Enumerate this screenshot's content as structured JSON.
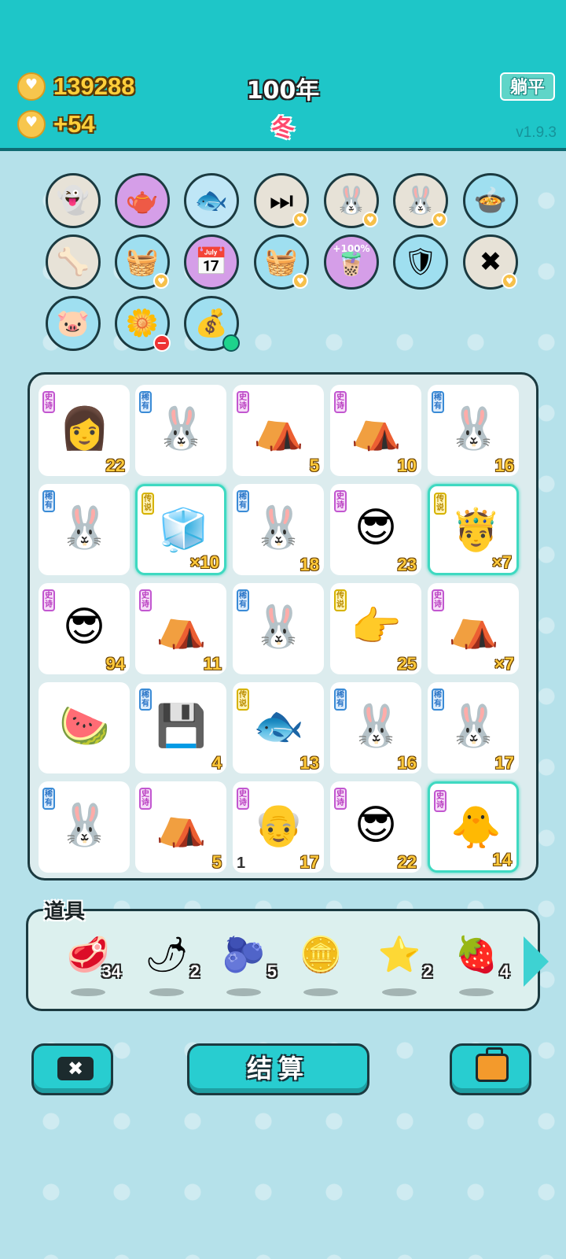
{
  "header": {
    "coins": "139288",
    "income": "+54",
    "year": "100年",
    "season": "冬",
    "flat_button": "躺平",
    "version": "v1.9.3"
  },
  "buffs": [
    {
      "icon": "ghost-icon",
      "glyph": "👻",
      "bg": "beige"
    },
    {
      "icon": "gravy-boat-icon",
      "glyph": "🫖",
      "bg": "purple"
    },
    {
      "icon": "fishbowl-icon",
      "glyph": "🐟",
      "bg": "blue"
    },
    {
      "icon": "skip-icon",
      "glyph": "⏭",
      "bg": "beige"
    },
    {
      "icon": "bunny-icon",
      "glyph": "🐰",
      "bg": "beige"
    },
    {
      "icon": "bunny-icon",
      "glyph": "🐰",
      "bg": "beige"
    },
    {
      "icon": "duck-pot-icon",
      "glyph": "🍲",
      "bg": "cyan"
    },
    {
      "icon": "dog-bowl-icon",
      "glyph": "🦴",
      "bg": "beige"
    },
    {
      "icon": "fruit-basket-icon",
      "glyph": "🧺",
      "bg": "cyan"
    },
    {
      "icon": "calendar-icon",
      "glyph": "📅",
      "bg": "purple"
    },
    {
      "icon": "fruit-basket-icon",
      "glyph": "🧺",
      "bg": "cyan"
    },
    {
      "icon": "milk-tea-icon",
      "glyph": "🧋",
      "bg": "purple",
      "label": "+100%"
    },
    {
      "icon": "shield-wrench-icon",
      "glyph": "🛡",
      "bg": "cyan"
    },
    {
      "icon": "delete-tag-icon",
      "glyph": "✖",
      "bg": "beige"
    },
    {
      "icon": "piggy-bank-icon",
      "glyph": "🐷",
      "bg": "cyan"
    },
    {
      "icon": "flower-pot-icon",
      "glyph": "🌼",
      "bg": "cyan"
    },
    {
      "icon": "sack-icon",
      "glyph": "💰",
      "bg": "cyan"
    }
  ],
  "rarity_labels": {
    "epic": "史诗",
    "rare": "稀有",
    "legendary": "传说"
  },
  "board": [
    {
      "name": "girl-portrait",
      "glyph": "👩",
      "rarity": "epic",
      "count": "22"
    },
    {
      "name": "bunny",
      "glyph": "🐰",
      "rarity": "rare",
      "count": ""
    },
    {
      "name": "bunny-tent",
      "glyph": "⛺",
      "rarity": "epic",
      "count": "5"
    },
    {
      "name": "bunny-tent",
      "glyph": "⛺",
      "rarity": "epic",
      "count": "10"
    },
    {
      "name": "bunny",
      "glyph": "🐰",
      "rarity": "rare",
      "count": "16"
    },
    {
      "name": "bunny",
      "glyph": "🐰",
      "rarity": "rare",
      "count": ""
    },
    {
      "name": "fridge",
      "glyph": "🧊",
      "rarity": "legendary",
      "count": "×10",
      "highlight": true
    },
    {
      "name": "bunny",
      "glyph": "🐰",
      "rarity": "rare",
      "count": "18"
    },
    {
      "name": "green-hat-man",
      "glyph": "😎",
      "rarity": "epic",
      "count": "23"
    },
    {
      "name": "king-egg",
      "glyph": "🤴",
      "rarity": "legendary",
      "count": "×7",
      "highlight": true
    },
    {
      "name": "green-hat-man",
      "glyph": "😎",
      "rarity": "epic",
      "count": "94"
    },
    {
      "name": "bunny-tent",
      "glyph": "⛺",
      "rarity": "epic",
      "count": "11"
    },
    {
      "name": "bunny",
      "glyph": "🐰",
      "rarity": "rare",
      "count": ""
    },
    {
      "name": "pointing-hand",
      "glyph": "👉",
      "rarity": "legendary",
      "count": "25"
    },
    {
      "name": "bunny-tent",
      "glyph": "⛺",
      "rarity": "epic",
      "count": "×7"
    },
    {
      "name": "watermelon",
      "glyph": "🍉",
      "rarity": "",
      "count": ""
    },
    {
      "name": "cpu-chip",
      "glyph": "💾",
      "rarity": "rare",
      "count": "4"
    },
    {
      "name": "koi-fish",
      "glyph": "🐟",
      "rarity": "legendary",
      "count": "13"
    },
    {
      "name": "bunny",
      "glyph": "🐰",
      "rarity": "rare",
      "count": "16"
    },
    {
      "name": "bunny",
      "glyph": "🐰",
      "rarity": "rare",
      "count": "17"
    },
    {
      "name": "bunny",
      "glyph": "🐰",
      "rarity": "rare",
      "count": ""
    },
    {
      "name": "bunny-tent",
      "glyph": "⛺",
      "rarity": "epic",
      "count": "5"
    },
    {
      "name": "grandpa",
      "glyph": "👴",
      "rarity": "epic",
      "count": "17",
      "left_count": "1"
    },
    {
      "name": "green-hat-man",
      "glyph": "😎",
      "rarity": "epic",
      "count": "22"
    },
    {
      "name": "rocker-chick",
      "glyph": "🐥",
      "rarity": "epic",
      "count": "14",
      "highlight": true
    }
  ],
  "tools": {
    "label": "道具",
    "items": [
      {
        "icon": "liver-icon",
        "glyph": "🥩",
        "count": "34"
      },
      {
        "icon": "chili-pepper-icon",
        "glyph": "🌶",
        "count": "2"
      },
      {
        "icon": "blueberry-icon",
        "glyph": "🫐",
        "count": "5"
      },
      {
        "icon": "orange-coin-icon",
        "glyph": "🪙",
        "count": ""
      },
      {
        "icon": "star-icon",
        "glyph": "⭐",
        "count": "2"
      },
      {
        "icon": "strawberry-icon",
        "glyph": "🍓",
        "count": "4"
      }
    ]
  },
  "buttons": {
    "settle": "结算"
  }
}
